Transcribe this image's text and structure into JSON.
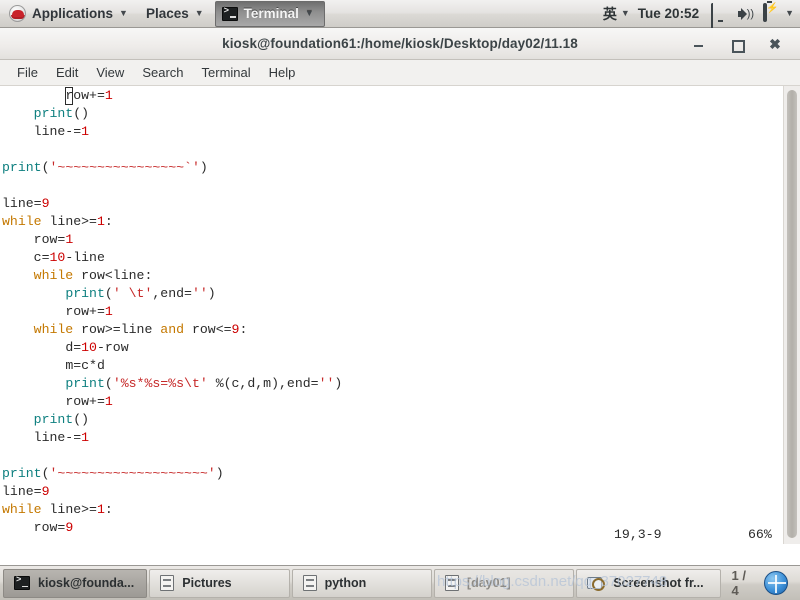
{
  "top_panel": {
    "applications_label": "Applications",
    "places_label": "Places",
    "active_window_label": "Terminal",
    "input_method": "英",
    "clock": "Tue 20:52",
    "arrow": "▼",
    "icons": [
      "redhat-icon",
      "terminal-icon",
      "display-icon",
      "volume-icon",
      "battery-icon",
      "chevron-down-icon"
    ]
  },
  "window": {
    "title": "kiosk@foundation61:/home/kiosk/Desktop/day02/11.18",
    "buttons": {
      "minimize": "−",
      "maximize": "□",
      "close": "✖"
    },
    "menu": [
      "File",
      "Edit",
      "View",
      "Search",
      "Terminal",
      "Help"
    ]
  },
  "terminal": {
    "status_position": "19,3-9",
    "status_percent": "66%",
    "cursor_char": "r",
    "lines": [
      {
        "indent": 8,
        "tokens": [
          {
            "t": "cursor",
            "v": "r"
          },
          {
            "t": "p",
            "v": "ow+="
          },
          {
            "t": "n",
            "v": "1"
          }
        ]
      },
      {
        "indent": 4,
        "tokens": [
          {
            "t": "f",
            "v": "print"
          },
          {
            "t": "p",
            "v": "()"
          }
        ]
      },
      {
        "indent": 4,
        "tokens": [
          {
            "t": "p",
            "v": "line-="
          },
          {
            "t": "n",
            "v": "1"
          }
        ]
      },
      {
        "indent": 0,
        "tokens": []
      },
      {
        "indent": 0,
        "tokens": [
          {
            "t": "f",
            "v": "print"
          },
          {
            "t": "p",
            "v": "("
          },
          {
            "t": "s",
            "v": "'~~~~~~~~~~~~~~~~`'"
          },
          {
            "t": "p",
            "v": ")"
          }
        ]
      },
      {
        "indent": 0,
        "tokens": []
      },
      {
        "indent": 0,
        "tokens": [
          {
            "t": "p",
            "v": "line="
          },
          {
            "t": "n",
            "v": "9"
          }
        ]
      },
      {
        "indent": 0,
        "tokens": [
          {
            "t": "k",
            "v": "while"
          },
          {
            "t": "p",
            "v": " line>="
          },
          {
            "t": "n",
            "v": "1"
          },
          {
            "t": "p",
            "v": ":"
          }
        ]
      },
      {
        "indent": 4,
        "tokens": [
          {
            "t": "p",
            "v": "row="
          },
          {
            "t": "n",
            "v": "1"
          }
        ]
      },
      {
        "indent": 4,
        "tokens": [
          {
            "t": "p",
            "v": "c="
          },
          {
            "t": "n",
            "v": "10"
          },
          {
            "t": "p",
            "v": "-line"
          }
        ]
      },
      {
        "indent": 4,
        "tokens": [
          {
            "t": "k",
            "v": "while"
          },
          {
            "t": "p",
            "v": " row<line:"
          }
        ]
      },
      {
        "indent": 8,
        "tokens": [
          {
            "t": "f",
            "v": "print"
          },
          {
            "t": "p",
            "v": "("
          },
          {
            "t": "s",
            "v": "' \\t'"
          },
          {
            "t": "p",
            "v": ",end="
          },
          {
            "t": "s",
            "v": "''"
          },
          {
            "t": "p",
            "v": ")"
          }
        ]
      },
      {
        "indent": 8,
        "tokens": [
          {
            "t": "p",
            "v": "row+="
          },
          {
            "t": "n",
            "v": "1"
          }
        ]
      },
      {
        "indent": 4,
        "tokens": [
          {
            "t": "k",
            "v": "while"
          },
          {
            "t": "p",
            "v": " row>=line "
          },
          {
            "t": "k",
            "v": "and"
          },
          {
            "t": "p",
            "v": " row<="
          },
          {
            "t": "n",
            "v": "9"
          },
          {
            "t": "p",
            "v": ":"
          }
        ]
      },
      {
        "indent": 8,
        "tokens": [
          {
            "t": "p",
            "v": "d="
          },
          {
            "t": "n",
            "v": "10"
          },
          {
            "t": "p",
            "v": "-row"
          }
        ]
      },
      {
        "indent": 8,
        "tokens": [
          {
            "t": "p",
            "v": "m=c*d"
          }
        ]
      },
      {
        "indent": 8,
        "tokens": [
          {
            "t": "f",
            "v": "print"
          },
          {
            "t": "p",
            "v": "("
          },
          {
            "t": "s",
            "v": "'%s*%s=%s\\t'"
          },
          {
            "t": "p",
            "v": " %(c,d,m),end="
          },
          {
            "t": "s",
            "v": "''"
          },
          {
            "t": "p",
            "v": ")"
          }
        ]
      },
      {
        "indent": 8,
        "tokens": [
          {
            "t": "p",
            "v": "row+="
          },
          {
            "t": "n",
            "v": "1"
          }
        ]
      },
      {
        "indent": 4,
        "tokens": [
          {
            "t": "f",
            "v": "print"
          },
          {
            "t": "p",
            "v": "()"
          }
        ]
      },
      {
        "indent": 4,
        "tokens": [
          {
            "t": "p",
            "v": "line-="
          },
          {
            "t": "n",
            "v": "1"
          }
        ]
      },
      {
        "indent": 0,
        "tokens": []
      },
      {
        "indent": 0,
        "tokens": [
          {
            "t": "f",
            "v": "print"
          },
          {
            "t": "p",
            "v": "("
          },
          {
            "t": "s",
            "v": "'~~~~~~~~~~~~~~~~~~~'"
          },
          {
            "t": "p",
            "v": ")"
          }
        ]
      },
      {
        "indent": 0,
        "tokens": [
          {
            "t": "p",
            "v": "line="
          },
          {
            "t": "n",
            "v": "9"
          }
        ]
      },
      {
        "indent": 0,
        "tokens": [
          {
            "t": "k",
            "v": "while"
          },
          {
            "t": "p",
            "v": " line>="
          },
          {
            "t": "n",
            "v": "1"
          },
          {
            "t": "p",
            "v": ":"
          }
        ]
      },
      {
        "indent": 4,
        "tokens": [
          {
            "t": "p",
            "v": "row="
          },
          {
            "t": "n",
            "v": "9"
          }
        ]
      }
    ]
  },
  "taskbar": {
    "items": [
      {
        "label": "kiosk@founda...",
        "icon": "terminal-icon",
        "state": "active"
      },
      {
        "label": "Pictures",
        "icon": "folder-icon",
        "state": "normal"
      },
      {
        "label": "python",
        "icon": "folder-icon",
        "state": "normal"
      },
      {
        "label": "[day01]",
        "icon": "folder-icon",
        "state": "dim"
      },
      {
        "label": "Screenshot fr...",
        "icon": "screenshot-icon",
        "state": "normal"
      }
    ],
    "workspace": "1 / 4",
    "watermark": "https://blog.csdn.net/qq_37027748"
  }
}
